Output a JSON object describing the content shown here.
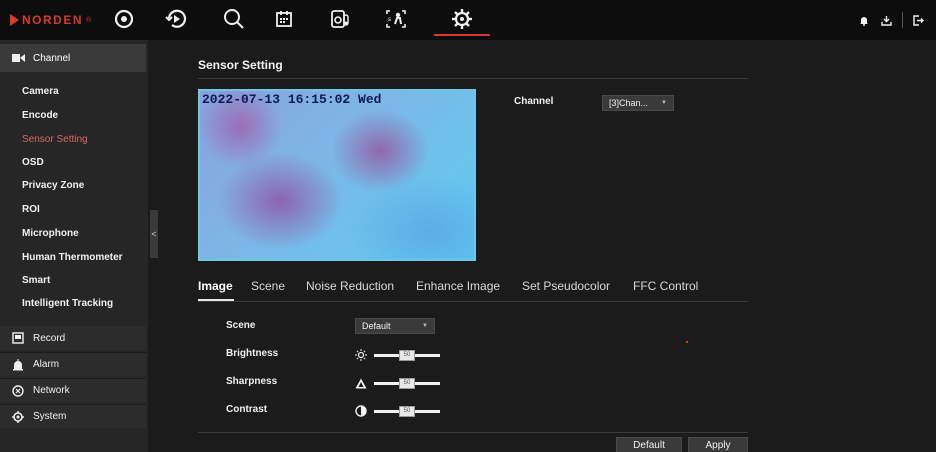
{
  "brand": {
    "name": "NORDEN",
    "registered": "®",
    "accent_color": "#d63a2f"
  },
  "topnav": {
    "icons": [
      "live-view-icon",
      "playback-icon",
      "search-icon",
      "calendar-icon",
      "temperature-icon",
      "ai-analysis-icon",
      "settings-icon"
    ],
    "active": "settings-icon",
    "right_icons": [
      "alarm-bell-icon",
      "download-icon",
      "logout-icon"
    ]
  },
  "sidebar": {
    "header": "Channel",
    "items": [
      {
        "label": "Camera",
        "active": false
      },
      {
        "label": "Encode",
        "active": false
      },
      {
        "label": "Sensor Setting",
        "active": true
      },
      {
        "label": "OSD",
        "active": false
      },
      {
        "label": "Privacy Zone",
        "active": false
      },
      {
        "label": "ROI",
        "active": false
      },
      {
        "label": "Microphone",
        "active": false
      },
      {
        "label": "Human Thermometer",
        "active": false
      },
      {
        "label": "Smart",
        "active": false
      },
      {
        "label": "Intelligent Tracking",
        "active": false
      }
    ],
    "groups": [
      {
        "label": "Record",
        "icon": "record-icon"
      },
      {
        "label": "Alarm",
        "icon": "alarm-icon"
      },
      {
        "label": "Network",
        "icon": "network-icon"
      },
      {
        "label": "System",
        "icon": "system-icon"
      }
    ],
    "collapse_glyph": "<"
  },
  "main": {
    "title": "Sensor Setting",
    "preview": {
      "timestamp": "2022-07-13 16:15:02 Wed"
    },
    "channel": {
      "label": "Channel",
      "value": "[3]Chan..."
    },
    "tabs": [
      {
        "label": "Image",
        "active": true
      },
      {
        "label": "Scene",
        "active": false
      },
      {
        "label": "Noise Reduction",
        "active": false
      },
      {
        "label": "Enhance Image",
        "active": false
      },
      {
        "label": "Set Pseudocolor",
        "active": false
      },
      {
        "label": "FFC Control",
        "active": false
      }
    ],
    "image_settings": {
      "scene": {
        "label": "Scene",
        "value": "Default"
      },
      "brightness": {
        "label": "Brightness",
        "value": 50,
        "min": 0,
        "max": 100
      },
      "sharpness": {
        "label": "Sharpness",
        "value": 50,
        "min": 0,
        "max": 100
      },
      "contrast": {
        "label": "Contrast",
        "value": 50,
        "min": 0,
        "max": 100
      }
    },
    "buttons": {
      "default": "Default",
      "apply": "Apply"
    }
  }
}
